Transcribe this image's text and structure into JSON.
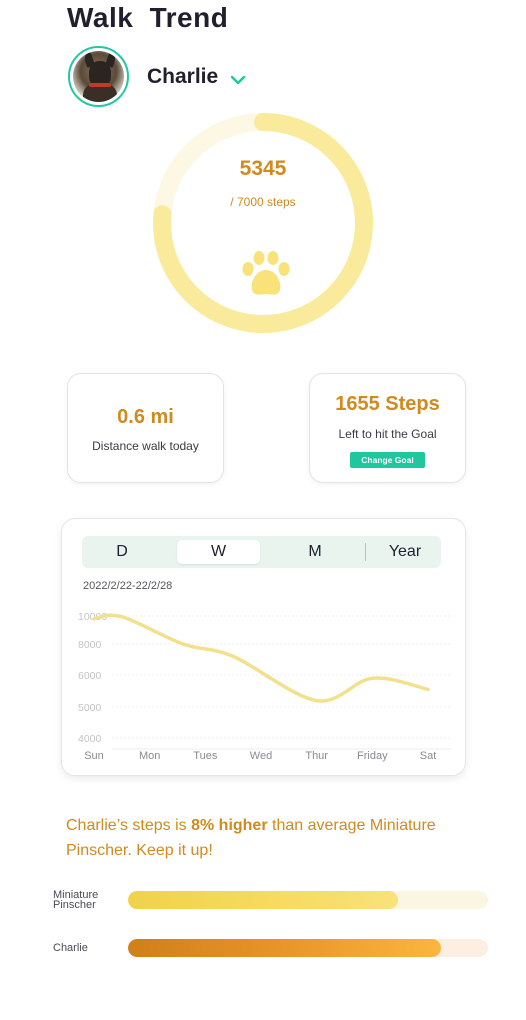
{
  "page": {
    "title": "Walk  Trend"
  },
  "pet": {
    "name": "Charlie"
  },
  "progress": {
    "steps": "5345",
    "goal_label": "/ 7000 steps",
    "fraction": 0.7636
  },
  "cards": {
    "distance": {
      "value": "0.6 mi",
      "label": "Distance walk today"
    },
    "steps_left": {
      "value": "1655 Steps",
      "label": "Left to hit the Goal",
      "button": "Change Goal"
    }
  },
  "trend": {
    "tabs": [
      "D",
      "W",
      "M",
      "Year"
    ],
    "selected_tab": "W",
    "date_range": "2022/2/22-22/2/28"
  },
  "chart_data": {
    "type": "line",
    "x": [
      "Sun",
      "Mon",
      "Tues",
      "Wed",
      "Thur",
      "Friday",
      "Sat"
    ],
    "series": [
      {
        "values": [
          9800,
          9950,
          8000,
          7200,
          5200,
          5900,
          5550
        ],
        "x_index": [
          0,
          0.5,
          1.6,
          2.5,
          4,
          5,
          6
        ]
      }
    ],
    "y_ticks": [
      10000,
      8000,
      6000,
      5000,
      4000
    ],
    "ylim": [
      4000,
      10000
    ],
    "grid": true,
    "line_color": "#f3e08c"
  },
  "comparison": {
    "before": "Charlie’s steps is ",
    "highlight": "8% higher",
    "after": "  than average Miniature Pinscher. Keep it up!"
  },
  "bars": [
    {
      "label_line1": "Miniature",
      "label_line2": "Pinscher",
      "fraction": 0.75
    },
    {
      "label": "Charlie",
      "fraction": 0.87
    }
  ],
  "colors": {
    "accent": "#d08a1e",
    "teal": "#1fc79f",
    "ring": "#faeb9c",
    "ring_track": "#fdf8e4"
  }
}
